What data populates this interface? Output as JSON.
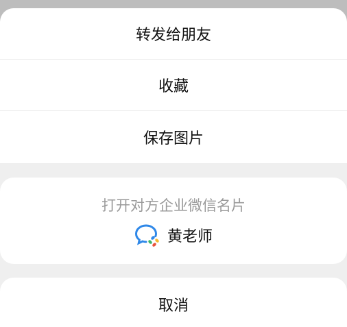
{
  "menu": {
    "items": [
      {
        "label": "转发给朋友"
      },
      {
        "label": "收藏"
      },
      {
        "label": "保存图片"
      }
    ]
  },
  "card": {
    "title": "打开对方企业微信名片",
    "contact_name": "黄老师",
    "icon": "wecom-chat-icon"
  },
  "cancel": {
    "label": "取消"
  },
  "colors": {
    "backdrop": "#bdbdbd",
    "sheet_bg": "#efefef",
    "item_bg": "#ffffff",
    "muted_text": "#9a9a9a",
    "icon_blue": "#2f88e8"
  }
}
